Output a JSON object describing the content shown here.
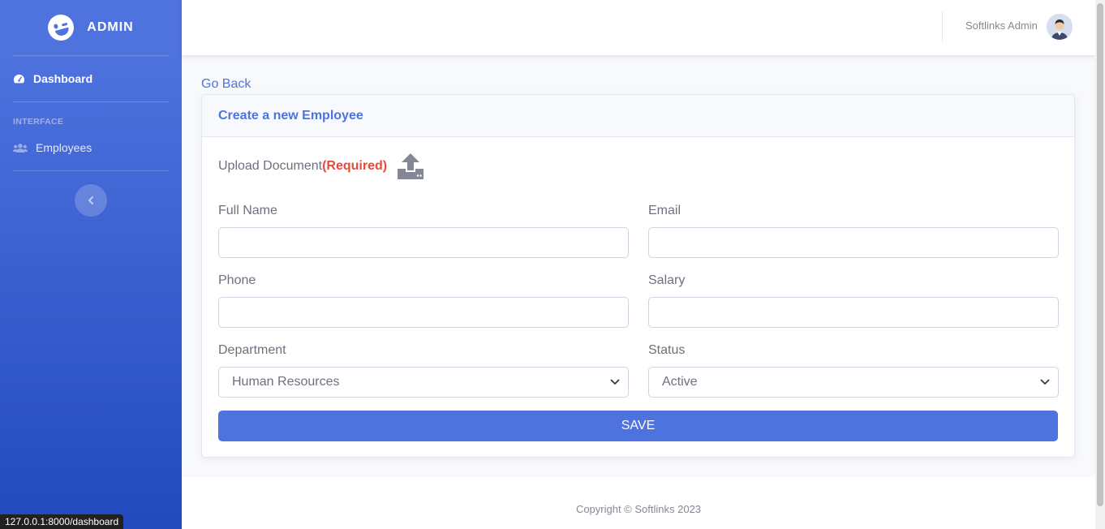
{
  "brand": {
    "name": "ADMIN"
  },
  "sidebar": {
    "items": [
      {
        "label": "Dashboard",
        "icon": "tachometer-icon"
      },
      {
        "label": "Employees",
        "icon": "users-icon"
      }
    ],
    "heading": "INTERFACE"
  },
  "topbar": {
    "user_name": "Softlinks Admin"
  },
  "page": {
    "go_back": "Go Back"
  },
  "form": {
    "title": "Create a new Employee",
    "upload_label": "Upload Document",
    "upload_required": "(Required)",
    "full_name_label": "Full Name",
    "full_name_value": "",
    "email_label": "Email",
    "email_value": "",
    "phone_label": "Phone",
    "phone_value": "",
    "salary_label": "Salary",
    "salary_value": "",
    "department_label": "Department",
    "department_value": "Human Resources",
    "status_label": "Status",
    "status_value": "Active",
    "save_label": "SAVE"
  },
  "footer": {
    "copyright": "Copyright © Softlinks 2023"
  },
  "browser": {
    "status_url": "127.0.0.1:8000/dashboard"
  },
  "colors": {
    "primary": "#4e73df",
    "danger": "#e74a3b",
    "text": "#858796"
  }
}
